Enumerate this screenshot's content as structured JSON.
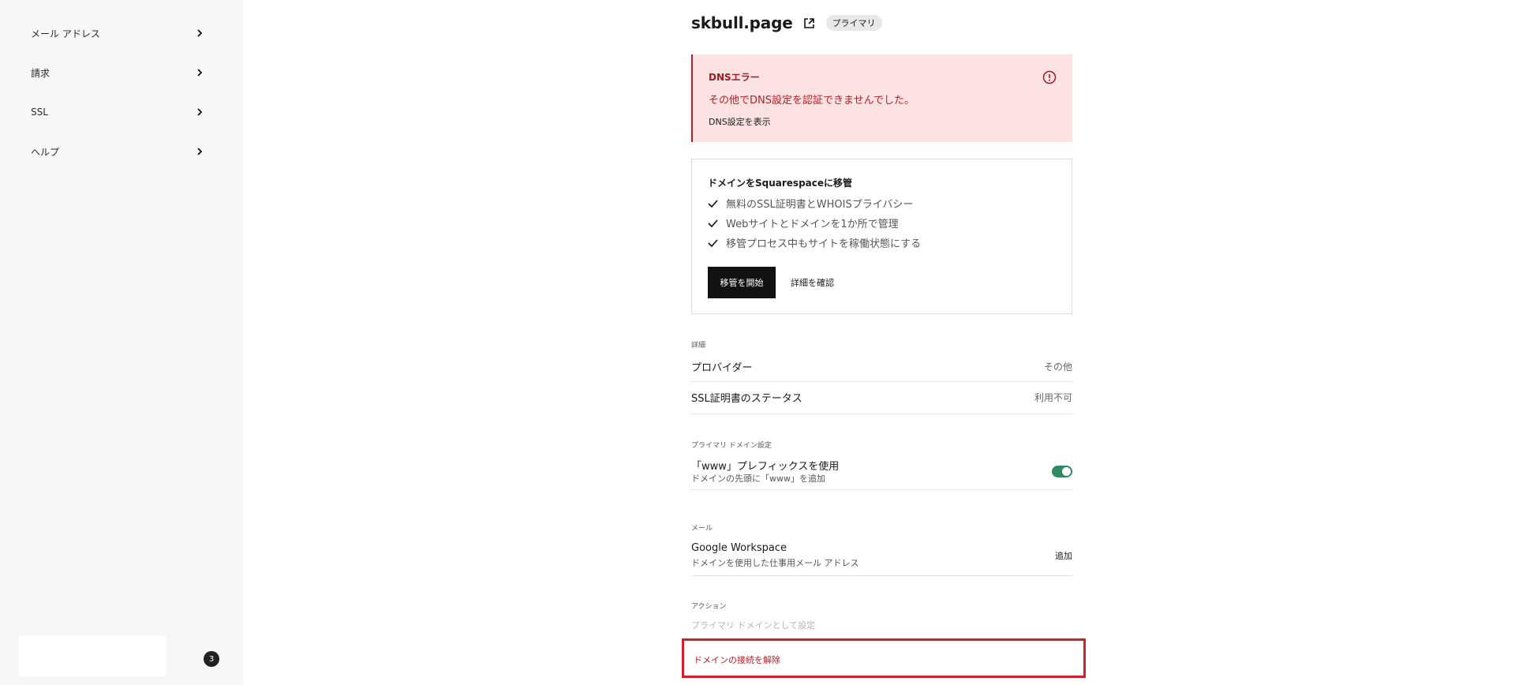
{
  "sidebar": {
    "items": [
      {
        "label": "メール アドレス"
      },
      {
        "label": "請求"
      },
      {
        "label": "SSL"
      },
      {
        "label": "ヘルプ"
      }
    ],
    "notification_count": "3"
  },
  "header": {
    "domain": "skbull.page",
    "badge": "プライマリ"
  },
  "dns_alert": {
    "title": "DNSエラー",
    "message": "その他でDNS設定を認証できませんでした。",
    "link": "DNS設定を表示"
  },
  "transfer": {
    "title": "ドメインをSquarespaceに移管",
    "benefits": [
      "無料のSSL証明書とWHOISプライバシー",
      "Webサイトとドメインを1か所で管理",
      "移管プロセス中もサイトを稼働状態にする"
    ],
    "start_button": "移管を開始",
    "details_link": "詳細を確認"
  },
  "details": {
    "section": "詳細",
    "provider_label": "プロバイダー",
    "provider_value": "その他",
    "ssl_label": "SSL証明書のステータス",
    "ssl_value": "利用不可"
  },
  "primary_settings": {
    "section": "プライマリ ドメイン設定",
    "www_label": "「www」プレフィックスを使用",
    "www_sub": "ドメインの先頭に「www」を追加",
    "www_enabled": true
  },
  "mail": {
    "section": "メール",
    "label": "Google Workspace",
    "sub": "ドメインを使用した仕事用メール アドレス",
    "action": "追加"
  },
  "actions": {
    "section": "アクション",
    "set_primary": "プライマリ ドメインとして設定",
    "disconnect": "ドメインの接続を解除"
  },
  "colors": {
    "alert_bg": "#fde2e2",
    "alert_text": "#b3202a",
    "toggle_on": "#2e8b61",
    "highlight": "#d0202e"
  }
}
